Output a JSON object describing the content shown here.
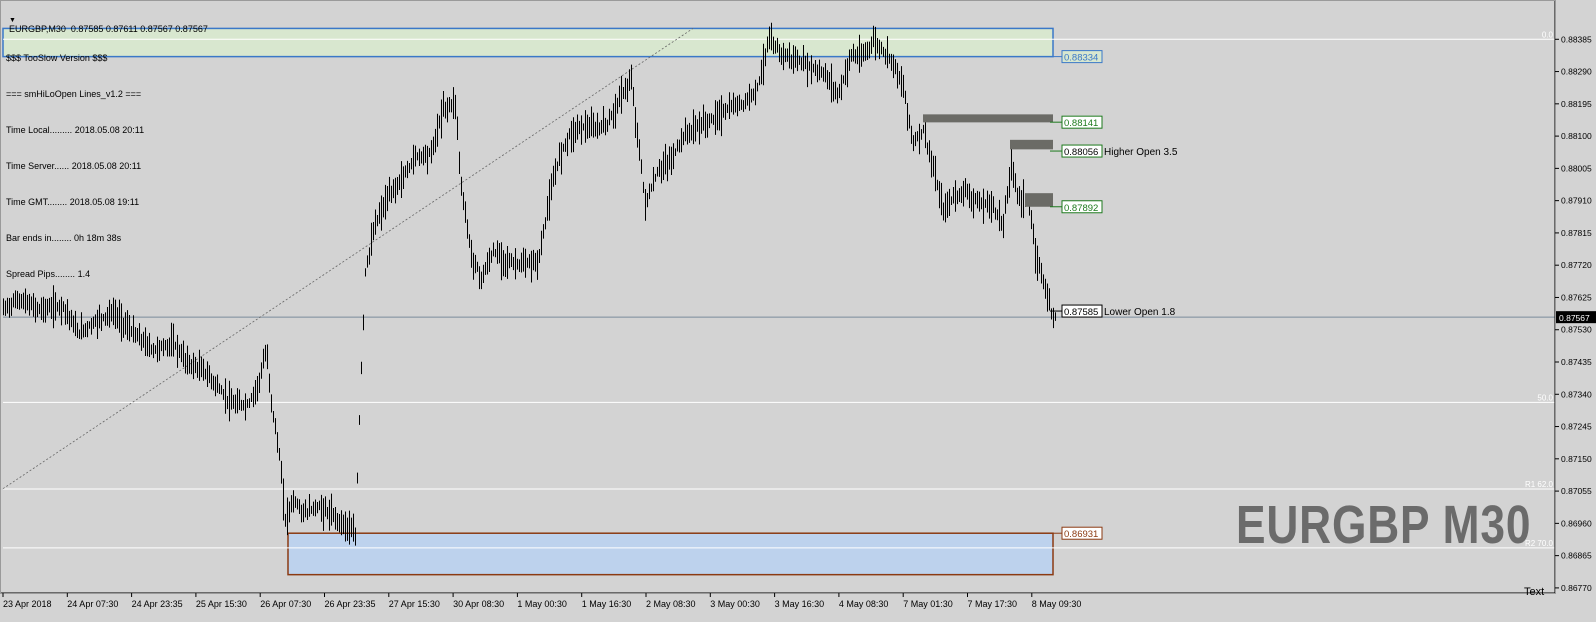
{
  "header": {
    "symbol_line": "EURGBP,M30  0.87585 0.87611 0.87567 0.87567"
  },
  "info_panel": {
    "title": "$$$ TooSlow Version $$$",
    "subtitle": "=== smHiLoOpen Lines_v1.2 ===",
    "lines": [
      {
        "label": "Time Local.........",
        "value": "2018.05.08 20:11"
      },
      {
        "label": "Time Server......",
        "value": "2018.05.08 20:11"
      },
      {
        "label": "Time GMT........",
        "value": "2018.05.08 19:11"
      },
      {
        "label": "Bar ends in........",
        "value": "0h 18m 38s"
      },
      {
        "label": "Spread Pips........",
        "value": "1.4"
      }
    ]
  },
  "watermark": "EURGBP M30",
  "corner_label": "Text",
  "colors": {
    "background": "#d3d3d3",
    "candle": "#000000",
    "upper_zone": "#d8e7cf",
    "upper_zone_border": "#3a78c8",
    "lower_zone": "#bdd2ed",
    "lower_zone_border": "#8b3a12",
    "level_green": "#1d7a1d",
    "supply_block": "#6b6b66",
    "current_price_bg": "#000000"
  },
  "chart_data": {
    "type": "candlestick",
    "ylim": [
      0.86755,
      0.8843
    ],
    "y_ticks": [
      "0.88385",
      "0.88290",
      "0.88195",
      "0.88100",
      "0.88005",
      "0.87910",
      "0.87815",
      "0.87720",
      "0.87625",
      "0.87530",
      "0.87435",
      "0.87340",
      "0.87245",
      "0.87150",
      "0.87055",
      "0.86960",
      "0.86865",
      "0.86770"
    ],
    "x_ticks": [
      "23 Apr 2018",
      "24 Apr 07:30",
      "24 Apr 23:35",
      "25 Apr 15:30",
      "26 Apr 07:30",
      "26 Apr 23:35",
      "27 Apr 15:30",
      "30 Apr 08:30",
      "1 May 00:30",
      "1 May 16:30",
      "2 May 08:30",
      "3 May 00:30",
      "3 May 16:30",
      "4 May 08:30",
      "7 May 01:30",
      "7 May 17:30",
      "8 May 09:30"
    ],
    "current_price": "0.87567",
    "price_path": [
      [
        0,
        0.8759
      ],
      [
        15,
        0.8762
      ],
      [
        35,
        0.8759
      ],
      [
        60,
        0.876
      ],
      [
        75,
        0.8752
      ],
      [
        95,
        0.8756
      ],
      [
        110,
        0.8758
      ],
      [
        130,
        0.8752
      ],
      [
        150,
        0.8747
      ],
      [
        170,
        0.8749
      ],
      [
        185,
        0.8743
      ],
      [
        200,
        0.8741
      ],
      [
        215,
        0.8736
      ],
      [
        228,
        0.8731
      ],
      [
        245,
        0.8731
      ],
      [
        255,
        0.8737
      ],
      [
        263,
        0.8747
      ],
      [
        268,
        0.8732
      ],
      [
        276,
        0.8716
      ],
      [
        282,
        0.8697
      ],
      [
        290,
        0.8703
      ],
      [
        300,
        0.8699
      ],
      [
        315,
        0.8701
      ],
      [
        330,
        0.8698
      ],
      [
        345,
        0.8695
      ],
      [
        352,
        0.8692
      ],
      [
        357,
        0.8735
      ],
      [
        362,
        0.877
      ],
      [
        372,
        0.8784
      ],
      [
        385,
        0.8792
      ],
      [
        400,
        0.8798
      ],
      [
        412,
        0.8804
      ],
      [
        428,
        0.8805
      ],
      [
        440,
        0.8818
      ],
      [
        452,
        0.882
      ],
      [
        458,
        0.8795
      ],
      [
        468,
        0.8775
      ],
      [
        478,
        0.8768
      ],
      [
        490,
        0.8776
      ],
      [
        505,
        0.8773
      ],
      [
        520,
        0.8772
      ],
      [
        535,
        0.8773
      ],
      [
        545,
        0.879
      ],
      [
        555,
        0.8803
      ],
      [
        565,
        0.881
      ],
      [
        578,
        0.8813
      ],
      [
        592,
        0.8812
      ],
      [
        605,
        0.8814
      ],
      [
        620,
        0.8823
      ],
      [
        628,
        0.8826
      ],
      [
        635,
        0.8808
      ],
      [
        642,
        0.879
      ],
      [
        655,
        0.88
      ],
      [
        668,
        0.8803
      ],
      [
        680,
        0.881
      ],
      [
        695,
        0.8813
      ],
      [
        710,
        0.8815
      ],
      [
        725,
        0.8818
      ],
      [
        742,
        0.882
      ],
      [
        755,
        0.8825
      ],
      [
        765,
        0.8838
      ],
      [
        780,
        0.8834
      ],
      [
        795,
        0.8832
      ],
      [
        810,
        0.883
      ],
      [
        822,
        0.8828
      ],
      [
        835,
        0.8822
      ],
      [
        848,
        0.8834
      ],
      [
        858,
        0.8833
      ],
      [
        870,
        0.8838
      ],
      [
        880,
        0.8835
      ],
      [
        890,
        0.8832
      ],
      [
        900,
        0.8824
      ],
      [
        910,
        0.8808
      ],
      [
        920,
        0.8812
      ],
      [
        930,
        0.88
      ],
      [
        940,
        0.8788
      ],
      [
        950,
        0.8792
      ],
      [
        962,
        0.8794
      ],
      [
        975,
        0.879
      ],
      [
        988,
        0.879
      ],
      [
        1000,
        0.8784
      ],
      [
        1008,
        0.8802
      ],
      [
        1015,
        0.8792
      ],
      [
        1025,
        0.8791
      ],
      [
        1032,
        0.8775
      ],
      [
        1040,
        0.8768
      ],
      [
        1048,
        0.8758
      ],
      [
        1052,
        0.8757
      ]
    ],
    "zones": [
      {
        "name": "upper-zone",
        "y_top": 0.88417,
        "y_bottom": 0.88334,
        "x_start": 0,
        "x_end": 1050
      },
      {
        "name": "lower-zone",
        "y_top": 0.86931,
        "y_bottom": 0.86809,
        "x_start": 285,
        "x_end": 1050
      }
    ],
    "supply_blocks": [
      {
        "y_top": 0.88164,
        "y_bottom": 0.88141,
        "x_start": 920,
        "x_end": 1050
      },
      {
        "y_top": 0.88089,
        "y_bottom": 0.88061,
        "x_start": 1007,
        "x_end": 1050
      },
      {
        "y_top": 0.87932,
        "y_bottom": 0.87892,
        "x_start": 1022,
        "x_end": 1050
      }
    ],
    "levels": [
      {
        "label": "0.88334",
        "value": 0.88334,
        "color": "#3a78c8",
        "fill": "#d8e7cf",
        "border": "#3a78c8"
      },
      {
        "label": "0.88141",
        "value": 0.88141,
        "color": "#1d7a1d",
        "fill": "#ffffff",
        "border": "#1d7a1d"
      },
      {
        "label": "0.88056",
        "value": 0.88056,
        "color": "#000000",
        "fill": "#ffffff",
        "border": "#1d7a1d"
      },
      {
        "label": "0.87892",
        "value": 0.87892,
        "color": "#1d7a1d",
        "fill": "#ffffff",
        "border": "#1d7a1d"
      },
      {
        "label": "0.87585",
        "value": 0.87585,
        "color": "#000000",
        "fill": "#ffffff",
        "border": "#000000"
      },
      {
        "label": "0.86931",
        "value": 0.86931,
        "color": "#8b3a12",
        "fill": "#ffffff",
        "border": "#8b3a12"
      }
    ],
    "line_labels": [
      {
        "text": "Higher Open 3.5",
        "value": 0.88056
      },
      {
        "text": "Lower Open 1.8",
        "value": 0.87585
      }
    ],
    "fib_levels": [
      {
        "label": "0.0",
        "value": 0.88385
      },
      {
        "label": "50.0",
        "value": 0.87316
      },
      {
        "label": "R1 62.0",
        "value": 0.87061
      },
      {
        "label": "R2 70.0",
        "value": 0.86888
      }
    ],
    "trendline": {
      "from": [
        0,
        0.87062
      ],
      "to": [
        690,
        0.88417
      ]
    }
  }
}
